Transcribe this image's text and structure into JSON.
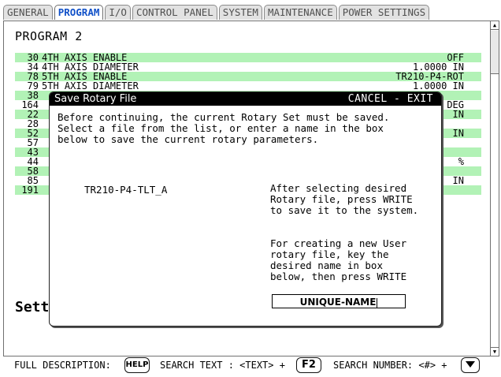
{
  "tabs": [
    "GENERAL",
    "PROGRAM",
    "I/O",
    "CONTROL PANEL",
    "SYSTEM",
    "MAINTENANCE",
    "POWER SETTINGS"
  ],
  "active_tab": "PROGRAM",
  "program_title": "PROGRAM 2",
  "settings_rows": [
    {
      "num": "30",
      "desc": "4TH AXIS ENABLE",
      "value": "OFF",
      "highlight": true
    },
    {
      "num": "34",
      "desc": "4TH AXIS DIAMETER",
      "value": "1.0000 IN",
      "highlight": false
    },
    {
      "num": "78",
      "desc": "5TH AXIS ENABLE",
      "value": "TR210-P4-ROT",
      "highlight": true
    },
    {
      "num": "79",
      "desc": "5TH AXIS DIAMETER",
      "value": "1.0000 IN",
      "highlight": false
    },
    {
      "num": "38",
      "desc": "",
      "value": "",
      "highlight": true
    },
    {
      "num": "164",
      "desc": "",
      "value": "DEG",
      "highlight": false
    },
    {
      "num": "22",
      "desc": "",
      "value": "IN",
      "highlight": true
    },
    {
      "num": "28",
      "desc": "",
      "value": "",
      "highlight": false
    },
    {
      "num": "52",
      "desc": "",
      "value": "IN",
      "highlight": true
    },
    {
      "num": "57",
      "desc": "",
      "value": "",
      "highlight": false
    },
    {
      "num": "43",
      "desc": "",
      "value": "",
      "highlight": true
    },
    {
      "num": "44",
      "desc": "",
      "value": "%",
      "highlight": false
    },
    {
      "num": "58",
      "desc": "",
      "value": "",
      "highlight": true
    },
    {
      "num": "85",
      "desc": "",
      "value": "IN",
      "highlight": false
    },
    {
      "num": "191",
      "desc": "",
      "value": "",
      "highlight": true
    }
  ],
  "settings_label": "Sett",
  "dialog": {
    "title": "Save Rotary File",
    "cancel_hint": "CANCEL - EXIT",
    "message_lines": [
      "Before continuing, the current Rotary Set must be saved.",
      "Select a file from the list, or enter a name in the box",
      "below to save the current rotary parameters."
    ],
    "file_list": [
      "TR210-P4-TLT_A"
    ],
    "hint_select_lines": [
      "After selecting desired",
      "Rotary file, press WRITE",
      "to save it to the system."
    ],
    "hint_new_lines": [
      "For creating a new User",
      "rotary file, key the",
      "desired name in box",
      "below, then press WRITE"
    ],
    "name_input_value": "UNIQUE-NAME"
  },
  "bottom_bar": {
    "full_description": "FULL DESCRIPTION:",
    "help_key": "HELP",
    "search_text": "SEARCH TEXT : <TEXT> +",
    "f2_key": "F2",
    "search_number": "SEARCH NUMBER: <#> +"
  },
  "icons": [
    "scroll-up-icon",
    "scroll-down-icon",
    "down-arrow-key-icon"
  ]
}
